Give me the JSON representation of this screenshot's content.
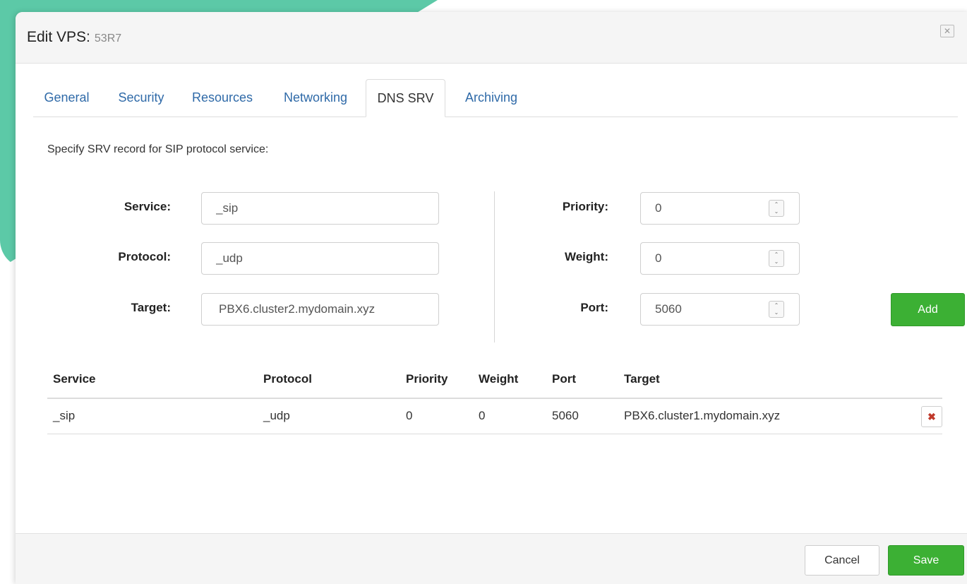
{
  "dialog": {
    "title": "Edit VPS:",
    "vps_id": "53R7",
    "close_glyph": "✕"
  },
  "tabs": [
    {
      "label": "General",
      "active": false
    },
    {
      "label": "Security",
      "active": false
    },
    {
      "label": "Resources",
      "active": false
    },
    {
      "label": "Networking",
      "active": false
    },
    {
      "label": "DNS SRV",
      "active": true
    },
    {
      "label": "Archiving",
      "active": false
    }
  ],
  "dns_srv": {
    "intro": "Specify SRV record for SIP protocol service:",
    "service": {
      "label": "Service:",
      "value": "_sip"
    },
    "protocol": {
      "label": "Protocol:",
      "value": "_udp"
    },
    "target": {
      "label": "Target:",
      "value": "PBX6.cluster2.mydomain.xyz"
    },
    "priority": {
      "label": "Priority:",
      "value": "0"
    },
    "weight": {
      "label": "Weight:",
      "value": "0"
    },
    "port": {
      "label": "Port:",
      "value": "5060"
    },
    "add_label": "Add",
    "spinner_up": "⌃",
    "spinner_down": "⌄"
  },
  "records_table": {
    "headers": [
      "Service",
      "Protocol",
      "Priority",
      "Weight",
      "Port",
      "Target"
    ],
    "rows": [
      [
        "_sip",
        "_udp",
        "0",
        "0",
        "5060",
        "PBX6.cluster1.mydomain.xyz"
      ]
    ],
    "delete_glyph": "✖"
  },
  "footer": {
    "cancel_label": "Cancel",
    "save_label": "Save"
  },
  "colors": {
    "accent_green": "#3cb034",
    "tab_link": "#2f6aa8",
    "background_shape": "#5cc9a7",
    "delete_red": "#c0392b"
  }
}
